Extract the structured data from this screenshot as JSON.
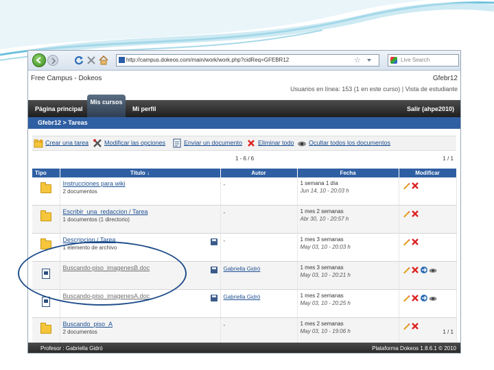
{
  "browser": {
    "url": "http://campus.dokeos.com/main/work/work.php?cidReq=GFEBR12",
    "search_placeholder": "Live Search"
  },
  "site": {
    "title": "Free Campus - Dokeos",
    "course_code": "Gfebr12",
    "user_info": "Usuarios en línea: 153 (1 en este curso) | Vista de estudiante"
  },
  "nav": {
    "home": "Página principal",
    "my_courses": "Mis cursos",
    "profile": "Mi perfil",
    "logout": "Salir (ahpe2010)"
  },
  "breadcrumb": "Gfebr12 > Tareas",
  "actions": [
    {
      "label": "Crear una tarea",
      "icon": "folder-add-icon"
    },
    {
      "label": "Modificar las opciones",
      "icon": "tools-icon"
    },
    {
      "label": "Enviar un documento",
      "icon": "upload-document-icon"
    },
    {
      "label": "Eliminar todo",
      "icon": "delete-icon"
    },
    {
      "label": "Ocultar todos los documentos",
      "icon": "hide-eye-icon"
    }
  ],
  "pager": {
    "range": "1 - 6 / 6",
    "pages": "1 / 1"
  },
  "table": {
    "headers": {
      "tipo": "Tipo",
      "titulo": "Título ↓",
      "autor": "Autor",
      "fecha": "Fecha",
      "modificar": "Modificar"
    },
    "rows": [
      {
        "type": "folder",
        "title": "Instrucciones para wiki",
        "subtitle": "2 documentos",
        "author": "-",
        "date": "1 semana 1 día",
        "date_sub": "Jun 14, 10 - 20:03 h",
        "mods": [
          "edit",
          "delete"
        ]
      },
      {
        "type": "folder",
        "title": "Escribir_una_redaccion / Tarea",
        "subtitle": "1 documentos (1 directorio)",
        "author": "-",
        "date": "1 mes 2 semanas",
        "date_sub": "Abr 30, 10 - 20:57 h",
        "mods": [
          "edit",
          "delete"
        ]
      },
      {
        "type": "folder",
        "title": "Descripcion / Tarea",
        "subtitle": "1 elemento de archivo",
        "save_icon": true,
        "author": "-",
        "date": "1 mes 3 semanas",
        "date_sub": "May 03, 10 - 20:03 h",
        "mods": [
          "edit",
          "delete"
        ]
      },
      {
        "type": "doc",
        "title": "Buscando-piso_imagenesB.doc",
        "gray": true,
        "save_icon": true,
        "author": "Gabriella Gidró",
        "date": "1 mes 3 semanas",
        "date_sub": "May 03, 10 - 20:21 h",
        "mods": [
          "edit",
          "delete",
          "move",
          "hide"
        ]
      },
      {
        "type": "doc",
        "title": "Buscando-piso_imagenesA.doc",
        "gray": true,
        "save_icon": true,
        "author": "Gabriella Gidró",
        "date": "1 mes 2 semanas",
        "date_sub": "May 03, 10 - 20:25 h",
        "mods": [
          "edit",
          "delete",
          "move",
          "hide"
        ]
      },
      {
        "type": "folder",
        "title": "Buscando_piso_A",
        "subtitle": "2 documentos",
        "author": "-",
        "date": "1 mes 2 semanas",
        "date_sub": "May 03, 10 - 19:06 h",
        "mods": [
          "edit",
          "delete"
        ]
      }
    ]
  },
  "footer": {
    "professor": "Profesor : Gabriella Gidró",
    "platform": "Plataforma Dokeos 1.8.6.1 © 2010"
  },
  "colors": {
    "nav_bg": "#2b2b2b",
    "breadcrumb_bg": "#2f5fa3",
    "table_header_bg": "#2f5fa3",
    "link": "#1d4f91",
    "annotation_ellipse": "#1f4e8a"
  }
}
